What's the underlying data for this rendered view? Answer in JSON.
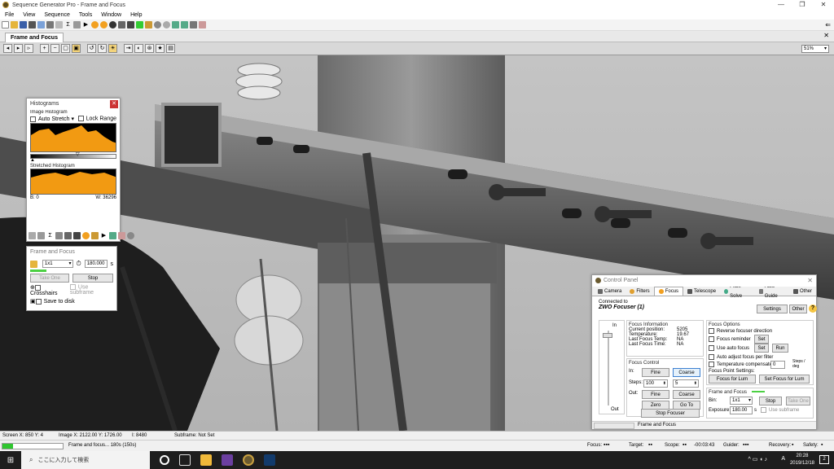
{
  "window": {
    "title": "Sequence Generator Pro - Frame and Focus",
    "min": "—",
    "max": "❐",
    "close": "✕"
  },
  "menu": [
    "File",
    "View",
    "Sequence",
    "Tools",
    "Window",
    "Help"
  ],
  "doc_tab": "Frame and Focus",
  "zoom": "51%",
  "histograms": {
    "title": "Histograms",
    "image_histogram": "Image Histogram",
    "auto_stretch": "Auto Stretch",
    "auto_stretch_arrow": "▾",
    "lock_range": "Lock Range",
    "stretched_histogram": "Stretched Histogram",
    "b_label": "B: 0",
    "w_label": "W:  36296"
  },
  "frame_focus": {
    "title": "Frame and Focus",
    "bin": "1x1",
    "exposure": "180.000",
    "exposure_unit": "s",
    "take_one": "Take One",
    "stop": "Stop",
    "crosshairs": "Crosshairs",
    "use_subframe": "Use subframe",
    "save_to_disk": "Save to disk"
  },
  "control_panel": {
    "title": "Control Panel",
    "tabs": [
      "Camera",
      "Filters",
      "Focus",
      "Telescope",
      "Plate Solve",
      "Auto Guide",
      "Other"
    ],
    "active_tab": "Focus",
    "connected_to": "Connected to",
    "device": "ZWO Focuser (1)",
    "settings_btn": "Settings",
    "other_btn": "Other",
    "help": "?",
    "slider_in": "In",
    "slider_out": "Out",
    "focus_info": {
      "heading": "Focus Information",
      "rows": [
        {
          "label": "Current position:",
          "value": "5205"
        },
        {
          "label": "Temperature:",
          "value": "19.67"
        },
        {
          "label": "Last Focus Temp:",
          "value": "NA"
        },
        {
          "label": "Last Focus Time:",
          "value": "NA"
        }
      ]
    },
    "focus_control": {
      "heading": "Focus Control",
      "in_label": "In:",
      "fine": "Fine",
      "coarse": "Coarse",
      "steps_label": "Steps:",
      "steps_fine": "100",
      "steps_coarse": "5",
      "out_label": "Out:",
      "zero": "Zero",
      "go_to": "Go To",
      "stop_focuser": "Stop Focuser"
    },
    "focus_options": {
      "heading": "Focus Options",
      "reverse": "Reverse focuser direction",
      "reminder": "Focus reminder",
      "use_auto": "Use auto focus",
      "set": "Set",
      "run": "Run",
      "auto_adjust": "Auto adjust focus per filter",
      "temp_comp": "Temperature compensate",
      "temp_val": "0",
      "steps_deg": "Steps / deg",
      "point_settings": "Focus Point Settings:",
      "focus_for_lum": "Focus for Lum",
      "set_focus_for_lum": "Set Focus for Lum"
    },
    "frame_and_focus": {
      "heading": "Frame and Focus",
      "bin_label": "Bin:",
      "bin": "1x1",
      "stop": "Stop",
      "take_one": "Take One",
      "exposure_label": "Exposure:",
      "exposure": "180.00",
      "exposure_unit": "s",
      "use_subframe": "Use subframe"
    },
    "bottom_tab": "Frame and Focus"
  },
  "status": {
    "screen": "Screen X: 850 Y: 4",
    "image": "Image X: 2122.00 Y: 1726.00",
    "intensity": "I: 8480",
    "subframe": "Subframe: Not Set"
  },
  "status2": {
    "progress_text": "Frame and focus... 180s (150s)",
    "progress_fraction": 0.17,
    "focus": "Focus:",
    "target": "Target:",
    "scope": "Scope:",
    "scope_time": "-00:03:43",
    "guider": "Guider:",
    "recovery": "Recovery:",
    "safety": "Safety:"
  },
  "taskbar": {
    "search_placeholder": "ここに入力して検索",
    "time": "20:28",
    "date": "2019/12/18",
    "ime": "A",
    "notify_count": "2"
  }
}
